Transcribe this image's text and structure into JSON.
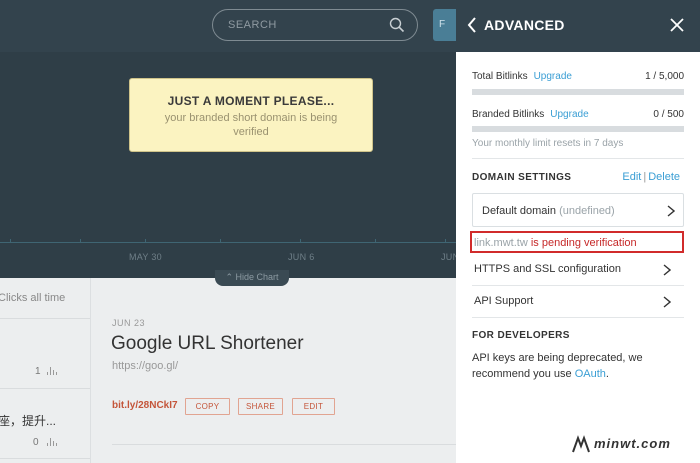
{
  "background_app": {
    "search": {
      "placeholder": "SEARCH",
      "icon": "search-icon"
    },
    "top_button_label": "F",
    "chart": {
      "x_labels": [
        "MAY 30",
        "JUN 6",
        "JUN"
      ],
      "hide_chart_label": "Hide Chart"
    },
    "modal": {
      "title": "JUST A MOMENT PLEASE...",
      "message": "your branded short domain is being verified"
    },
    "list": {
      "clicks_all_time": "Clicks all time",
      "items": [
        {
          "text": "",
          "count": "1"
        },
        {
          "text": "座，提升...",
          "count": "0"
        }
      ]
    },
    "link": {
      "date": "JUN 23",
      "title": "Google URL Shortener",
      "url": "https://goo.gl/",
      "short": "bit.ly/28NCkI7",
      "buttons": [
        "COPY",
        "SHARE",
        "EDIT"
      ]
    }
  },
  "panel": {
    "title": "ADVANCED",
    "stats": [
      {
        "label": "Total Bitlinks",
        "upgrade": "Upgrade",
        "value": "1 / 5,000",
        "fraction": 0.0002
      },
      {
        "label": "Branded Bitlinks",
        "upgrade": "Upgrade",
        "value": "0 / 500",
        "fraction": 0
      }
    ],
    "reset_note": "Your monthly limit resets in 7 days",
    "domain_settings": {
      "title": "DOMAIN SETTINGS",
      "edit": "Edit",
      "divider": "|",
      "delete": "Delete",
      "default_domain_label": "Default domain",
      "default_domain_value": "(undefined)",
      "pending_domain": "link.mwt.tw",
      "pending_text": " is pending verification"
    },
    "menu": [
      "HTTPS and SSL configuration",
      "API Support"
    ],
    "developers": {
      "title": "FOR DEVELOPERS",
      "text": "API keys are being deprecated, we recommend you use ",
      "link": "OAuth",
      "after": "."
    }
  },
  "watermark": "minwt.com",
  "colors": {
    "header": "#33434d",
    "accent": "#3a9ed4",
    "alert": "#d12b2b",
    "short_link": "#c4553a",
    "modal_bg": "#fbf3c1"
  }
}
